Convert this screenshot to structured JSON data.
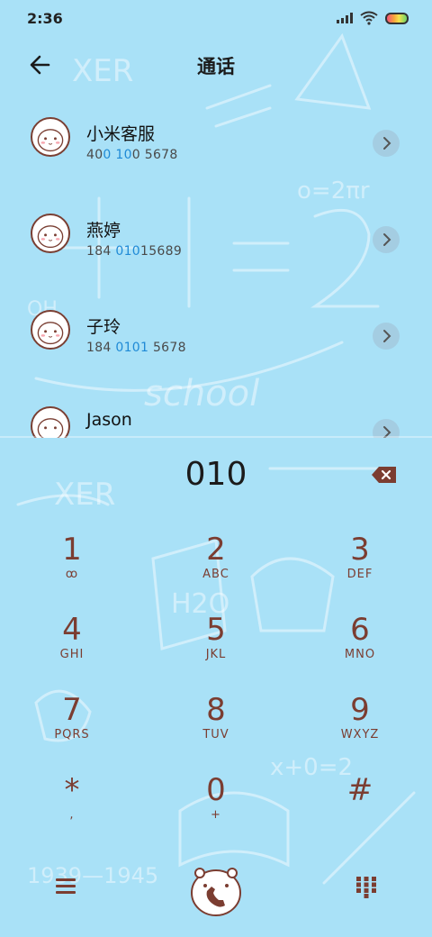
{
  "status": {
    "time": "2:36"
  },
  "header": {
    "title": "通话",
    "back_icon": "arrow-left-icon"
  },
  "contacts": [
    {
      "name": "小米客服",
      "number_parts": [
        "40",
        "0 10",
        "0 5678"
      ],
      "highlight": [
        false,
        true,
        false
      ]
    },
    {
      "name": "燕婷",
      "number_parts": [
        "184 ",
        "010",
        "15689"
      ],
      "highlight": [
        false,
        true,
        false
      ]
    },
    {
      "name": "子玲",
      "number_parts": [
        "184 ",
        "0101",
        " 5678"
      ],
      "highlight": [
        false,
        true,
        false
      ]
    },
    {
      "name": "Jason",
      "number_parts": [
        "",
        "",
        ""
      ],
      "highlight": [
        false,
        false,
        false
      ]
    }
  ],
  "dialer": {
    "entered": "010",
    "delete_icon": "backspace-icon"
  },
  "keypad": [
    {
      "digit": "1",
      "letters": "ꝏ"
    },
    {
      "digit": "2",
      "letters": "ABC"
    },
    {
      "digit": "3",
      "letters": "DEF"
    },
    {
      "digit": "4",
      "letters": "GHI"
    },
    {
      "digit": "5",
      "letters": "JKL"
    },
    {
      "digit": "6",
      "letters": "MNO"
    },
    {
      "digit": "7",
      "letters": "PQRS"
    },
    {
      "digit": "8",
      "letters": "TUV"
    },
    {
      "digit": "9",
      "letters": "WXYZ"
    },
    {
      "digit": "*",
      "letters": ","
    },
    {
      "digit": "0",
      "letters": "+"
    },
    {
      "digit": "#",
      "letters": ""
    }
  ],
  "bottom": {
    "menu_icon": "hamburger-menu-icon",
    "call_icon": "phone-call-icon",
    "grid_icon": "dialpad-grid-icon"
  },
  "colors": {
    "background": "#a9e1f7",
    "accent": "#7b3d31",
    "highlight": "#1f8ad6"
  }
}
